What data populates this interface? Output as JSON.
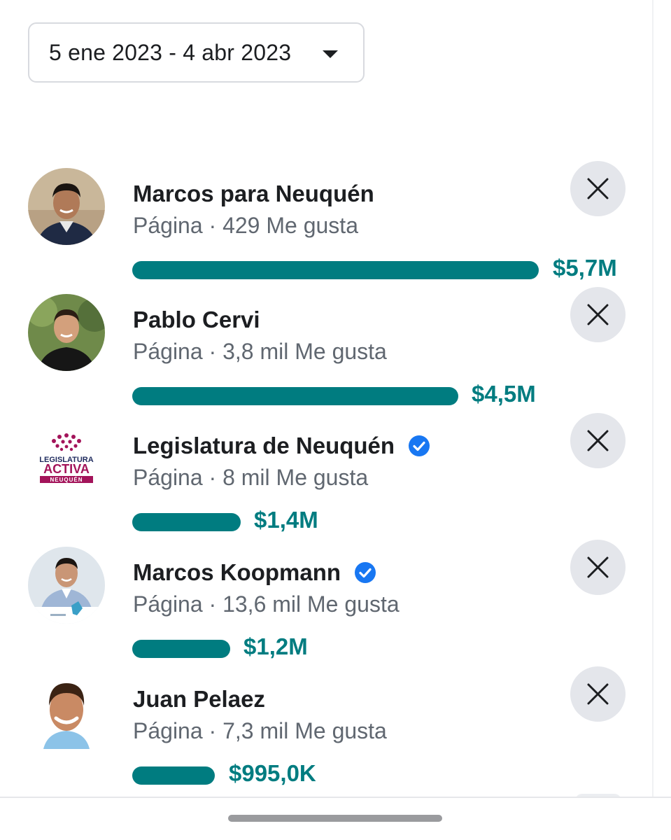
{
  "date_range": {
    "label": "5 ene 2023 - 4 abr 2023",
    "dropdown_icon": "caret-down-icon"
  },
  "advertisers": [
    {
      "name": "Marcos para Neuquén",
      "meta": "Página · 429 Me gusta",
      "amount": "$5,7M",
      "spend_millions": 5.7,
      "verified": false,
      "avatar": "photo-man-dark-jacket"
    },
    {
      "name": "Pablo Cervi",
      "meta": "Página · 3,8 mil Me gusta",
      "amount": "$4,5M",
      "spend_millions": 4.5,
      "verified": false,
      "avatar": "photo-man-black-shirt"
    },
    {
      "name": "Legislatura de Neuquén",
      "meta": "Página · 8 mil Me gusta",
      "amount": "$1,4M",
      "spend_millions": 1.4,
      "verified": true,
      "avatar": "logo-legislatura-activa",
      "logo_text": {
        "line1": "LEGISLATURA",
        "line2": "ACTIVA",
        "line3": "NEUQUÉN"
      }
    },
    {
      "name": "Marcos Koopmann",
      "meta": "Página · 13,6 mil Me gusta",
      "amount": "$1,2M",
      "spend_millions": 1.2,
      "verified": true,
      "avatar": "photo-man-light-shirt"
    },
    {
      "name": "Juan Pelaez",
      "meta": "Página · 7,3 mil Me gusta",
      "amount": "$995,0K",
      "spend_millions": 0.995,
      "verified": false,
      "avatar": "photo-man-smiling"
    }
  ],
  "icons": {
    "close": "close-icon",
    "verified": "verified-badge-icon"
  },
  "colors": {
    "accent": "#007c80",
    "verified": "#1877f2",
    "close_bg": "#e4e6eb",
    "logo_magenta": "#a3145a",
    "logo_navy": "#1f2b5e"
  }
}
